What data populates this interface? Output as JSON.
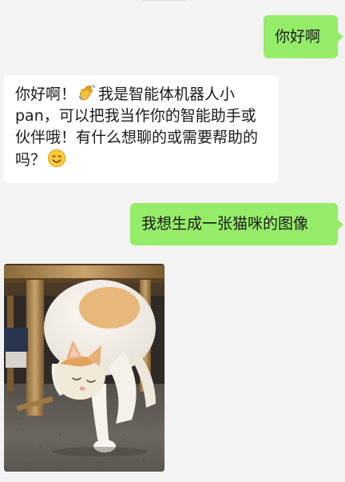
{
  "chat": {
    "messages": [
      {
        "sender": "user",
        "type": "text",
        "text": "你好啊"
      },
      {
        "sender": "bot",
        "type": "text",
        "text_before_wave": "你好啊！",
        "wave_icon": "waving-hand-emoji",
        "text_middle": "我是智能体机器人小pan，可以把我当作你的智能助手或伙伴哦！有什么想聊的或需要帮助的吗？",
        "smile_icon": "smiling-face-emoji"
      },
      {
        "sender": "user",
        "type": "text",
        "text": "我想生成一张猫咪的图像"
      },
      {
        "sender": "bot",
        "type": "image",
        "image_subject": "cat-photo"
      }
    ]
  },
  "colors": {
    "background": "#f3f3f3",
    "user_bubble": "#95ec69",
    "bot_bubble": "#ffffff",
    "text": "#191919"
  }
}
